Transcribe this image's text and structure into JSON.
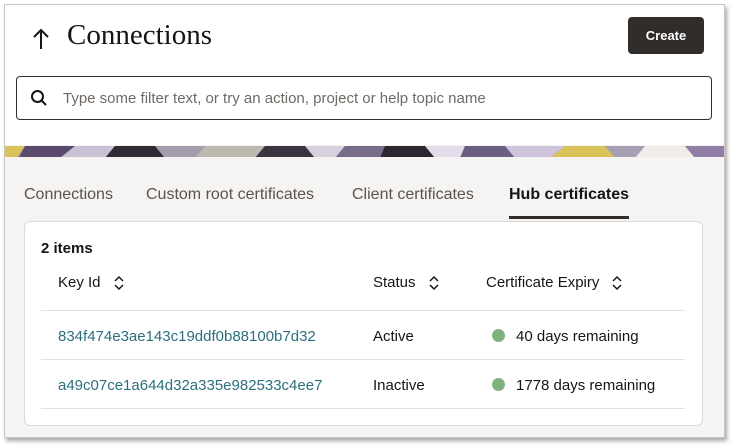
{
  "header": {
    "title": "Connections",
    "create_label": "Create"
  },
  "search": {
    "placeholder": "Type some filter text, or try an action, project or help topic name",
    "value": ""
  },
  "tabs": [
    {
      "label": "Connections",
      "active": false
    },
    {
      "label": "Custom root certificates",
      "active": false
    },
    {
      "label": "Client certificates",
      "active": false
    },
    {
      "label": "Hub certificates",
      "active": true
    }
  ],
  "table": {
    "item_count": "2 items",
    "columns": [
      "Key Id",
      "Status",
      "Certificate Expiry"
    ],
    "rows": [
      {
        "key_id": "834f474e3ae143c19ddf0b88100b7d32",
        "status": "Active",
        "expiry": "40 days remaining"
      },
      {
        "key_id": "a49c07ce1a644d32a335e982533c4ee7",
        "status": "Inactive",
        "expiry": "1778 days remaining"
      }
    ]
  },
  "colors": {
    "accent_dark": "#312d2a",
    "link": "#2b6f7e",
    "status_ok": "#7fb27f"
  },
  "icons": {
    "back": "arrow-up-icon",
    "search": "search-icon",
    "sort": "sort-updown-icon",
    "status": "status-dot-icon"
  }
}
